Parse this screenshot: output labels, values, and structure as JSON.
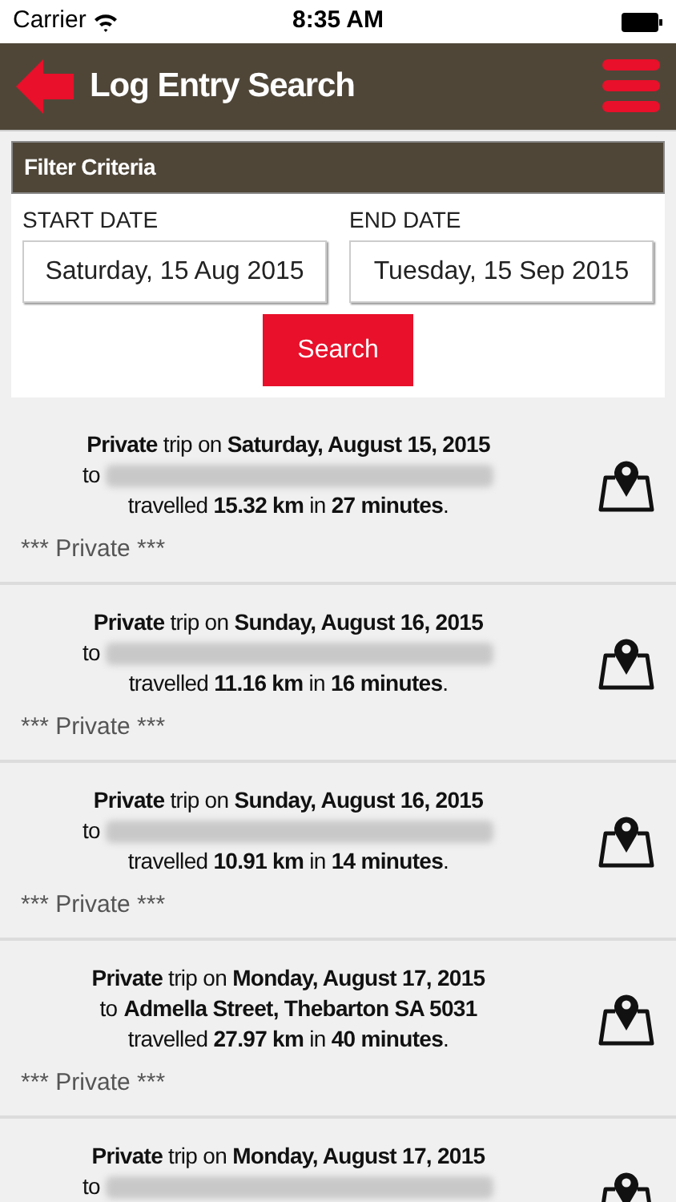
{
  "status_bar": {
    "carrier": "Carrier",
    "time": "8:35 AM"
  },
  "nav_bar": {
    "title": "Log Entry Search"
  },
  "filter": {
    "title": "Filter Criteria",
    "start_label": "START DATE",
    "start_value": "Saturday, 15 Aug 2015",
    "end_label": "END DATE",
    "end_value": "Tuesday, 15 Sep 2015",
    "button": "Search"
  },
  "trips": [
    {
      "summary": "**Private** trip on **Saturday, August 15, 2015**",
      "to": "to",
      "destination": {
        "kind": "redacted"
      },
      "travel": "travelled **15.32 km** in **27 minutes**.",
      "note": "*** Private ***"
    },
    {
      "summary": "**Private** trip on **Sunday, August 16, 2015**",
      "to": "to",
      "destination": {
        "kind": "redacted"
      },
      "travel": "travelled **11.16 km** in **16 minutes**.",
      "note": "*** Private ***"
    },
    {
      "summary": "**Private** trip on **Sunday, August 16, 2015**",
      "to": "to",
      "destination": {
        "kind": "redacted"
      },
      "travel": "travelled **10.91 km** in **14 minutes**.",
      "note": "*** Private ***"
    },
    {
      "summary": "**Private** trip on **Monday, August 17, 2015**",
      "to": "to",
      "destination": {
        "kind": "address",
        "text": "Admella Street, Thebarton SA 5031"
      },
      "travel": "travelled **27.97 km** in **40 minutes**.",
      "note": "*** Private ***"
    },
    {
      "summary": "**Private** trip on **Monday, August 17, 2015**",
      "to": "to",
      "destination": {
        "kind": "redacted"
      }
    }
  ]
}
